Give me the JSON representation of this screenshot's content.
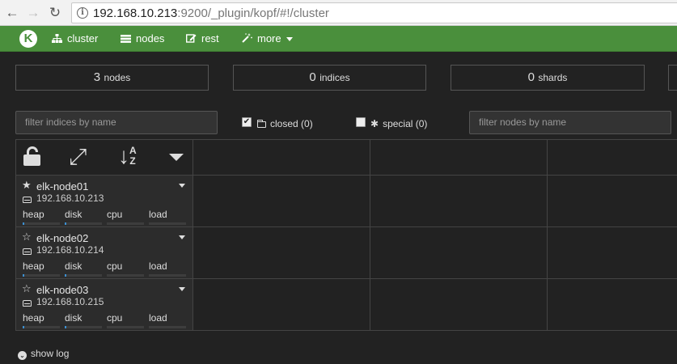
{
  "browser": {
    "url_host": "192.168.10.213",
    "url_rest": ":9200/_plugin/kopf/#!/cluster",
    "back_glyph": "←",
    "forward_glyph": "→",
    "reload_glyph": "↻",
    "info_glyph": "i"
  },
  "navbar": {
    "logo_letter": "K",
    "items": [
      {
        "label": "cluster",
        "icon": "sitemap-icon"
      },
      {
        "label": "nodes",
        "icon": "list-icon"
      },
      {
        "label": "rest",
        "icon": "edit-icon"
      },
      {
        "label": "more",
        "icon": "wand-icon"
      }
    ],
    "colors": {
      "bar": "#4a8f3c"
    }
  },
  "stats": {
    "nodes": {
      "value": "3",
      "label": "nodes"
    },
    "indices": {
      "value": "0",
      "label": "indices"
    },
    "shards": {
      "value": "0",
      "label": "shards"
    }
  },
  "filters": {
    "indices_placeholder": "filter indices by name",
    "closed_label": "closed (0)",
    "closed_checked": true,
    "special_label": "special (0)",
    "special_checked": false,
    "nodes_placeholder": "filter nodes by name"
  },
  "toolbar": {
    "sort_letters": "A Z"
  },
  "nodes": [
    {
      "name": "elk-node01",
      "ip": "192.168.10.213",
      "master": true,
      "metrics": [
        {
          "label": "heap",
          "level": 4
        },
        {
          "label": "disk",
          "level": 4
        },
        {
          "label": "cpu",
          "level": 0
        },
        {
          "label": "load",
          "level": 0
        }
      ]
    },
    {
      "name": "elk-node02",
      "ip": "192.168.10.214",
      "master": false,
      "metrics": [
        {
          "label": "heap",
          "level": 4
        },
        {
          "label": "disk",
          "level": 4
        },
        {
          "label": "cpu",
          "level": 0
        },
        {
          "label": "load",
          "level": 0
        }
      ]
    },
    {
      "name": "elk-node03",
      "ip": "192.168.10.215",
      "master": false,
      "metrics": [
        {
          "label": "heap",
          "level": 4
        },
        {
          "label": "disk",
          "level": 4
        },
        {
          "label": "cpu",
          "level": 0
        },
        {
          "label": "load",
          "level": 0
        }
      ]
    }
  ],
  "footer": {
    "show_log": "show log"
  }
}
